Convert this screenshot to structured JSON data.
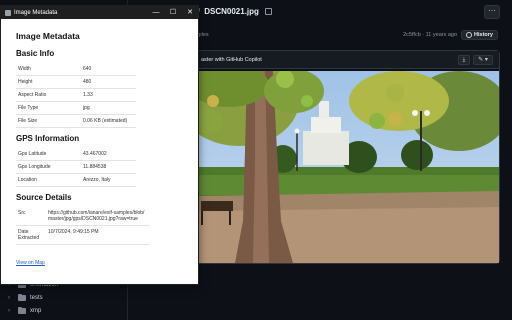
{
  "popup": {
    "title": "Image Metadata",
    "controls": {
      "minimize": "—",
      "maximize": "☐",
      "close": "✕"
    },
    "heading": "Image Metadata",
    "basic_info": {
      "heading": "Basic Info",
      "rows": [
        {
          "key": "Width",
          "value": "640"
        },
        {
          "key": "Height",
          "value": "480"
        },
        {
          "key": "Aspect Ratio",
          "value": "1.33"
        },
        {
          "key": "File Type",
          "value": "jpg"
        },
        {
          "key": "File Size",
          "value": "0.06 KB (estimated)"
        }
      ]
    },
    "gps_info": {
      "heading": "GPS Information",
      "rows": [
        {
          "key": "Gps Latitude",
          "value": "43.467002"
        },
        {
          "key": "Gps Longitude",
          "value": "11.884538"
        },
        {
          "key": "Location",
          "value": "Arezzo, Italy"
        }
      ]
    },
    "source_details": {
      "heading": "Source Details",
      "rows": [
        {
          "key": "Src",
          "value": "https://github.com/ianare/exif-samples/blob/master/jpg/gps/DSCN0021.jpg?raw=true"
        },
        {
          "key": "Date Extracted",
          "value": "10/7/2024, 9:49:15 PM"
        }
      ]
    },
    "map_link": "View on Map"
  },
  "github": {
    "breadcrumb": {
      "separator": "/",
      "file": "DSCN0021.jpg"
    },
    "more_button": "···",
    "commit_bar": {
      "left_text": "mples",
      "hash_time": "2c5ffcb · 11 years ago",
      "history_label": "History"
    },
    "file_header": {
      "label": "aster with GitHub Copilot"
    },
    "sidebar_items": [
      {
        "label": "orientation"
      },
      {
        "label": "tests"
      },
      {
        "label": "xmp"
      }
    ]
  },
  "colors": {
    "accent": "#2f81f7",
    "github_bg": "#0d1117",
    "popup_titlebar": "#1f1f1f",
    "link": "#2255cc"
  }
}
